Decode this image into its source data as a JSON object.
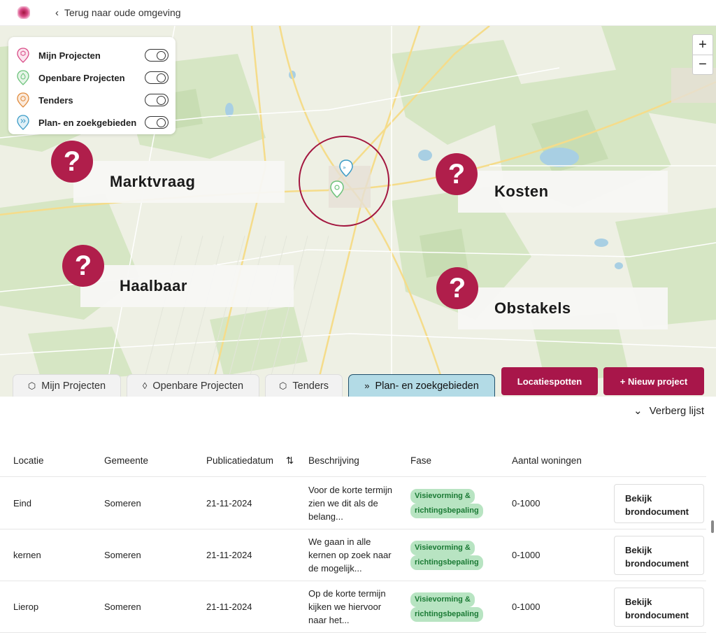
{
  "topbar": {
    "back_label": "Terug naar oude omgeving"
  },
  "map": {
    "zoom_in": "+",
    "zoom_out": "−",
    "legend": [
      {
        "label": "Mijn Projecten",
        "color": "#d94a86",
        "icon": "cube-pin-icon"
      },
      {
        "label": "Openbare Projecten",
        "color": "#6cc27a",
        "icon": "drop-pin-icon"
      },
      {
        "label": "Tenders",
        "color": "#e08a3c",
        "icon": "hex-pin-icon"
      },
      {
        "label": "Plan- en zoekgebieden",
        "color": "#3a9bc7",
        "icon": "chevrons-pin-icon"
      }
    ],
    "questions": {
      "q_symbol": "?",
      "marktvraag": "Marktvraag",
      "kosten": "Kosten",
      "haalbaar": "Haalbaar",
      "obstakels": "Obstakels"
    }
  },
  "tabs": [
    {
      "label": "Mijn Projecten",
      "icon": "cube-icon"
    },
    {
      "label": "Openbare Projecten",
      "icon": "drop-icon"
    },
    {
      "label": "Tenders",
      "icon": "hexagon-icon"
    },
    {
      "label": "Plan- en zoekgebieden",
      "icon": "chevrons-icon",
      "active": true
    }
  ],
  "actions": {
    "locatiespotten": "Locatiespotten",
    "new_project": "+ Nieuw project"
  },
  "list": {
    "hide_label": "Verberg lijst"
  },
  "table": {
    "headers": [
      "Locatie",
      "Gemeente",
      "Publicatiedatum",
      "Beschrijving",
      "Fase",
      "Aantal woningen"
    ],
    "rows": [
      {
        "locatie": "Eind",
        "gemeente": "Someren",
        "datum": "21-11-2024",
        "beschrijving": "Voor de korte termijn zien we dit als de belang...",
        "fase_1": "Visievorming &",
        "fase_2": "richtingsbepaling",
        "woningen": "0-1000",
        "doc": "Bekijk brondocument"
      },
      {
        "locatie": "kernen",
        "gemeente": "Someren",
        "datum": "21-11-2024",
        "beschrijving": "We gaan in alle kernen op zoek naar de mogelijk...",
        "fase_1": "Visievorming &",
        "fase_2": "richtingsbepaling",
        "woningen": "0-1000",
        "doc": "Bekijk brondocument"
      },
      {
        "locatie": "Lierop",
        "gemeente": "Someren",
        "datum": "21-11-2024",
        "beschrijving": "Op de korte termijn kijken we hiervoor naar het...",
        "fase_1": "Visievorming &",
        "fase_2": "richtingsbepaling",
        "woningen": "0-1000",
        "doc": "Bekijk brondocument"
      }
    ]
  }
}
